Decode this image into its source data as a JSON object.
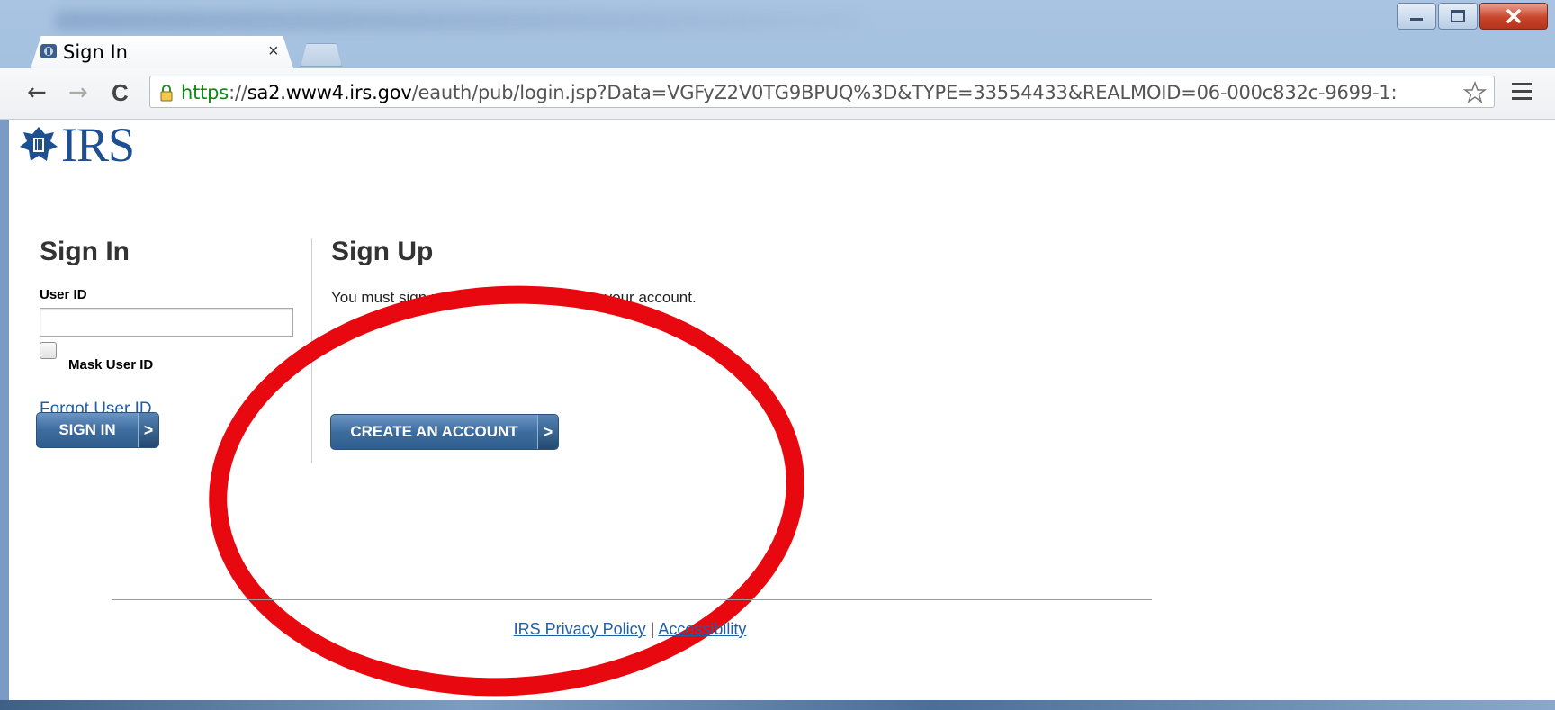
{
  "browser": {
    "tab_title": "Sign In",
    "tab_close": "×",
    "url_scheme": "https",
    "url_sep": "://",
    "url_host": "sa2.www4.irs.gov",
    "url_path": "/eauth/pub/login.jsp?Data=VGFyZ2V0TG9BPUQ%3D&TYPE=33554433&REALMOID=06-000c832c-9699-1:",
    "back_glyph": "←",
    "forward_glyph": "→",
    "reload_glyph": "C"
  },
  "logo": {
    "text": "IRS"
  },
  "signin": {
    "title": "Sign In",
    "user_id_label": "User ID",
    "user_id_value": "",
    "mask_label": "Mask User ID",
    "forgot_link": "Forgot User ID",
    "button_label": "SIGN IN",
    "button_arrow": ">"
  },
  "signup": {
    "title": "Sign Up",
    "text": "You must sign up to create or reactivate your account.",
    "button_label": "CREATE AN ACCOUNT",
    "button_arrow": ">"
  },
  "footer": {
    "privacy_link": "IRS Privacy Policy",
    "separator": "|",
    "accessibility_link": "Accessibility"
  },
  "colors": {
    "accent_blue": "#1d4f91",
    "link_blue": "#1f5fa6",
    "annotation_red": "#e8080f"
  }
}
